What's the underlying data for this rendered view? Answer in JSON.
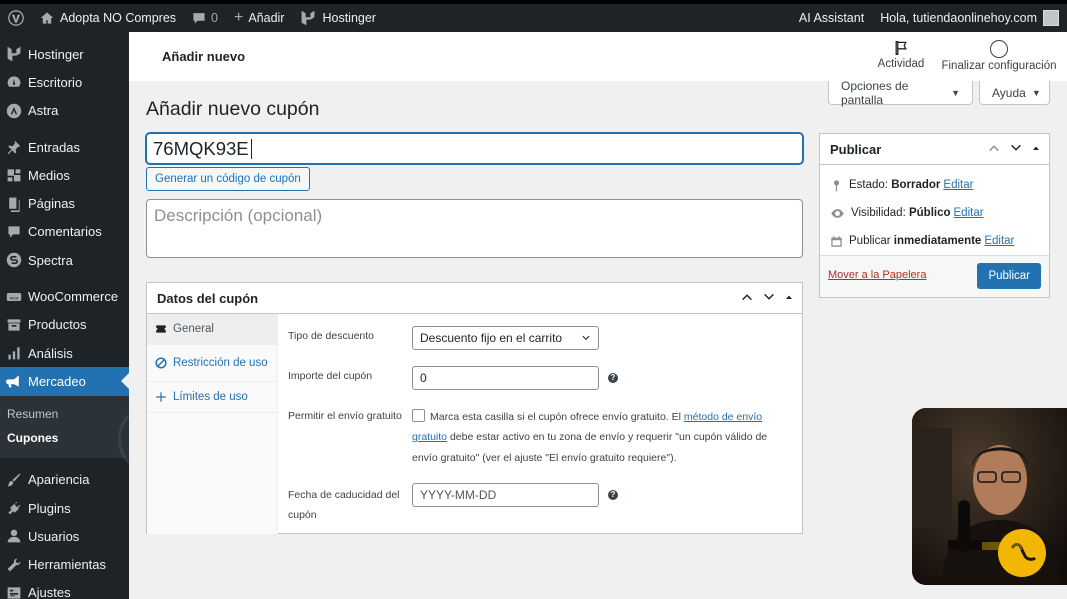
{
  "adminbar": {
    "site_name": "Adopta NO Compres",
    "comments_count": "0",
    "new_label": "Añadir",
    "hosting_label": "Hostinger",
    "ai_label": "AI Assistant",
    "greeting": "Hola, tutiendaonlinehoy.com"
  },
  "sidebar": {
    "items": [
      {
        "label": "Hostinger",
        "icon": "hostinger-icon"
      },
      {
        "label": "Escritorio",
        "icon": "dashboard-icon"
      },
      {
        "label": "Astra",
        "icon": "astra-icon"
      },
      {
        "label": "Entradas",
        "icon": "pin-icon"
      },
      {
        "label": "Medios",
        "icon": "media-icon"
      },
      {
        "label": "Páginas",
        "icon": "page-icon"
      },
      {
        "label": "Comentarios",
        "icon": "comment-icon"
      },
      {
        "label": "Spectra",
        "icon": "spectra-icon"
      },
      {
        "label": "WooCommerce",
        "icon": "woo-icon"
      },
      {
        "label": "Productos",
        "icon": "archive-icon"
      },
      {
        "label": "Análisis",
        "icon": "chart-icon"
      },
      {
        "label": "Mercadeo",
        "icon": "megaphone-icon"
      },
      {
        "label": "Apariencia",
        "icon": "brush-icon"
      },
      {
        "label": "Plugins",
        "icon": "plugin-icon"
      },
      {
        "label": "Usuarios",
        "icon": "user-icon"
      },
      {
        "label": "Herramientas",
        "icon": "wrench-icon"
      },
      {
        "label": "Ajustes",
        "icon": "settings-icon"
      }
    ],
    "submenu": [
      "Resumen",
      "Cupones"
    ]
  },
  "header": {
    "title": "Añadir nuevo",
    "activity": "Actividad",
    "finish": "Finalizar configuración"
  },
  "screen_options": "Opciones de pantalla",
  "help": "Ayuda",
  "page_title": "Añadir nuevo cupón",
  "coupon_code": "76MQK93E",
  "generate_button": "Generar un código de cupón",
  "description_placeholder": "Descripción (opcional)",
  "coupon_data": {
    "title": "Datos del cupón",
    "tabs": [
      "General",
      "Restricción de uso",
      "Límites de uso"
    ],
    "discount_type_label": "Tipo de descuento",
    "discount_type_value": "Descuento fijo en el carrito",
    "amount_label": "Importe del cupón",
    "amount_value": "0",
    "free_shipping_label": "Permitir el envío gratuito",
    "free_shipping_text_1": "Marca esta casilla si el cupón ofrece envío gratuito. El",
    "free_shipping_link": "método de envío gratuito",
    "free_shipping_text_2": "debe estar activo en tu zona de envío y requerir \"un cupón válido de envío gratuito\" (ver el ajuste \"El envío gratuito requiere\").",
    "expiry_label": "Fecha de caducidad del cupón",
    "expiry_placeholder": "YYYY-MM-DD"
  },
  "publish": {
    "title": "Publicar",
    "status_label": "Estado:",
    "status_value": "Borrador",
    "visibility_label": "Visibilidad:",
    "visibility_value": "Público",
    "publish_label": "Publicar",
    "publish_value": "inmediatamente",
    "edit": "Editar",
    "trash": "Mover a la Papelera",
    "button": "Publicar"
  }
}
